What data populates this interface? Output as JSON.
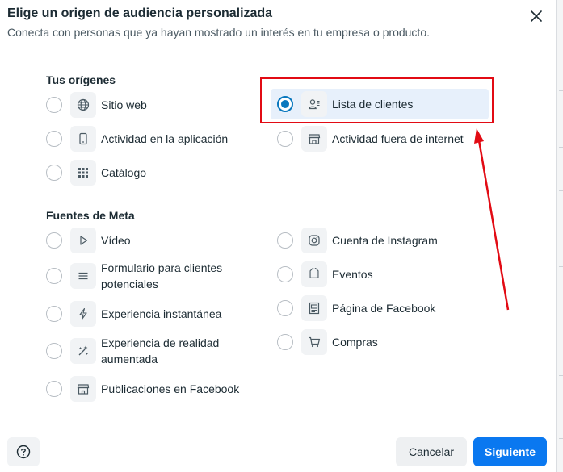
{
  "dialog": {
    "title": "Elige un origen de audiencia personalizada",
    "subtitle": "Conecta con personas que ya hayan mostrado un interés en tu empresa o producto."
  },
  "sections": {
    "own": {
      "title": "Tus orígenes",
      "options": [
        {
          "label": "Sitio web",
          "icon": "globe-icon",
          "selected": false
        },
        {
          "label": "Actividad en la aplicación",
          "icon": "mobile-phone-icon",
          "selected": false
        },
        {
          "label": "Catálogo",
          "icon": "grid-icon",
          "selected": false
        },
        {
          "label": "Lista de clientes",
          "icon": "customer-list-icon",
          "selected": true
        },
        {
          "label": "Actividad fuera de internet",
          "icon": "store-icon",
          "selected": false
        }
      ]
    },
    "meta": {
      "title": "Fuentes de Meta",
      "options": [
        {
          "label": "Vídeo",
          "icon": "play-icon",
          "selected": false
        },
        {
          "label": "Formulario para clientes potenciales",
          "icon": "lines-icon",
          "selected": false
        },
        {
          "label": "Experiencia instantánea",
          "icon": "lightning-icon",
          "selected": false
        },
        {
          "label": "Experiencia de realidad aumentada",
          "icon": "sparkle-icon",
          "selected": false
        },
        {
          "label": "Publicaciones en Facebook",
          "icon": "shop-icon",
          "selected": false
        },
        {
          "label": "Cuenta de Instagram",
          "icon": "instagram-icon",
          "selected": false
        },
        {
          "label": "Eventos",
          "icon": "tag-icon",
          "selected": false
        },
        {
          "label": "Página de Facebook",
          "icon": "page-icon",
          "selected": false
        },
        {
          "label": "Compras",
          "icon": "cart-icon",
          "selected": false
        }
      ]
    }
  },
  "footer": {
    "help_icon": "question-icon",
    "cancel_label": "Cancelar",
    "next_label": "Siguiente"
  },
  "annotation": {
    "color": "#e20b14",
    "highlight_target": "Lista de clientes"
  },
  "colors": {
    "primary": "#0a78f0",
    "selected_radio": "#0a78be",
    "selected_row_bg": "#e7f0fb"
  }
}
